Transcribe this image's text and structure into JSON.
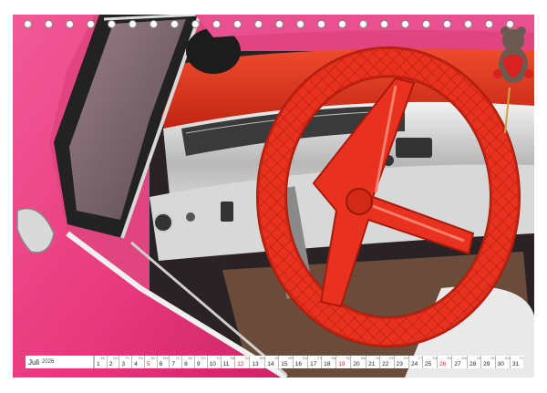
{
  "calendar": {
    "month": "Juli",
    "year": "2026",
    "days": [
      {
        "n": "1",
        "wd": "Mi",
        "red": false
      },
      {
        "n": "2",
        "wd": "Do",
        "red": false
      },
      {
        "n": "3",
        "wd": "Fr",
        "red": false
      },
      {
        "n": "4",
        "wd": "Sa",
        "red": false
      },
      {
        "n": "5",
        "wd": "So",
        "red": true
      },
      {
        "n": "6",
        "wd": "Mo",
        "red": false
      },
      {
        "n": "7",
        "wd": "Di",
        "red": false
      },
      {
        "n": "8",
        "wd": "Mi",
        "red": false
      },
      {
        "n": "9",
        "wd": "Do",
        "red": false
      },
      {
        "n": "10",
        "wd": "Fr",
        "red": false
      },
      {
        "n": "11",
        "wd": "Sa",
        "red": false
      },
      {
        "n": "12",
        "wd": "So",
        "red": true
      },
      {
        "n": "13",
        "wd": "Mo",
        "red": false
      },
      {
        "n": "14",
        "wd": "Di",
        "red": false
      },
      {
        "n": "15",
        "wd": "Mi",
        "red": false
      },
      {
        "n": "16",
        "wd": "Do",
        "red": false
      },
      {
        "n": "17",
        "wd": "Fr",
        "red": false
      },
      {
        "n": "18",
        "wd": "Sa",
        "red": false
      },
      {
        "n": "19",
        "wd": "So",
        "red": true
      },
      {
        "n": "20",
        "wd": "Mo",
        "red": false
      },
      {
        "n": "21",
        "wd": "Di",
        "red": false
      },
      {
        "n": "22",
        "wd": "Mi",
        "red": false
      },
      {
        "n": "23",
        "wd": "Do",
        "red": false
      },
      {
        "n": "24",
        "wd": "Fr",
        "red": false
      },
      {
        "n": "25",
        "wd": "Sa",
        "red": false
      },
      {
        "n": "26",
        "wd": "So",
        "red": true
      },
      {
        "n": "27",
        "wd": "Mo",
        "red": false
      },
      {
        "n": "28",
        "wd": "Di",
        "red": false
      },
      {
        "n": "29",
        "wd": "Mi",
        "red": false
      },
      {
        "n": "30",
        "wd": "Do",
        "red": false
      },
      {
        "n": "31",
        "wd": "Fr",
        "red": false
      }
    ]
  },
  "colors": {
    "car_pink": "#e8377c",
    "wheel_red": "#e8321f",
    "dash_chrome": "#c9c9c9",
    "sunday_red": "#d2232a"
  },
  "photo": {
    "subject": [
      "red-steering-wheel",
      "pink-car-body",
      "chrome-dashboard",
      "teddy-bear-ornament"
    ]
  }
}
